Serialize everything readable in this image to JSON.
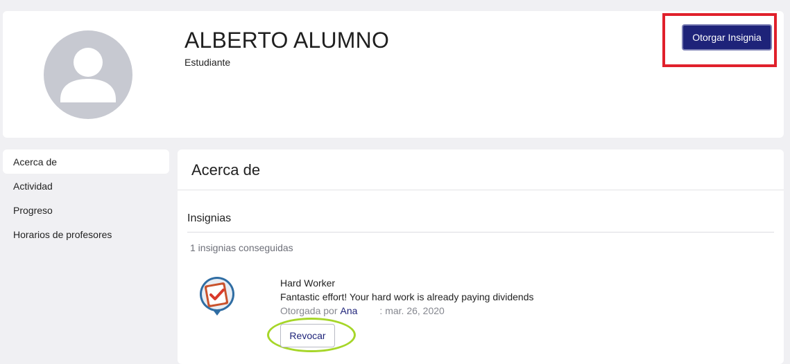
{
  "profile": {
    "name": "ALBERTO ALUMNO",
    "role": "Estudiante",
    "avatar_icon": "user-avatar-icon",
    "award_button_label": "Otorgar Insignia"
  },
  "sidebar": {
    "items": [
      {
        "label": "Acerca de",
        "active": true
      },
      {
        "label": "Actividad",
        "active": false
      },
      {
        "label": "Progreso",
        "active": false
      },
      {
        "label": "Horarios de profesores",
        "active": false
      }
    ]
  },
  "main": {
    "title": "Acerca de",
    "badges_section": {
      "title": "Insignias",
      "count_text": "1 insignias conseguidas",
      "badges": [
        {
          "name": "Hard Worker",
          "description": "Fantastic effort! Your hard work is already paying dividends",
          "awarded_by_label": "Otorgada por",
          "awarded_by": "Ana",
          "date": ": mar. 26, 2020",
          "revoke_label": "Revocar",
          "icon": "checklist-badge-icon"
        }
      ]
    }
  },
  "colors": {
    "primary": "#1e2379",
    "highlight_red": "#e0202b",
    "highlight_green": "#a6d629",
    "avatar_bg": "#c7c9d1",
    "page_bg": "#f0f0f3"
  }
}
